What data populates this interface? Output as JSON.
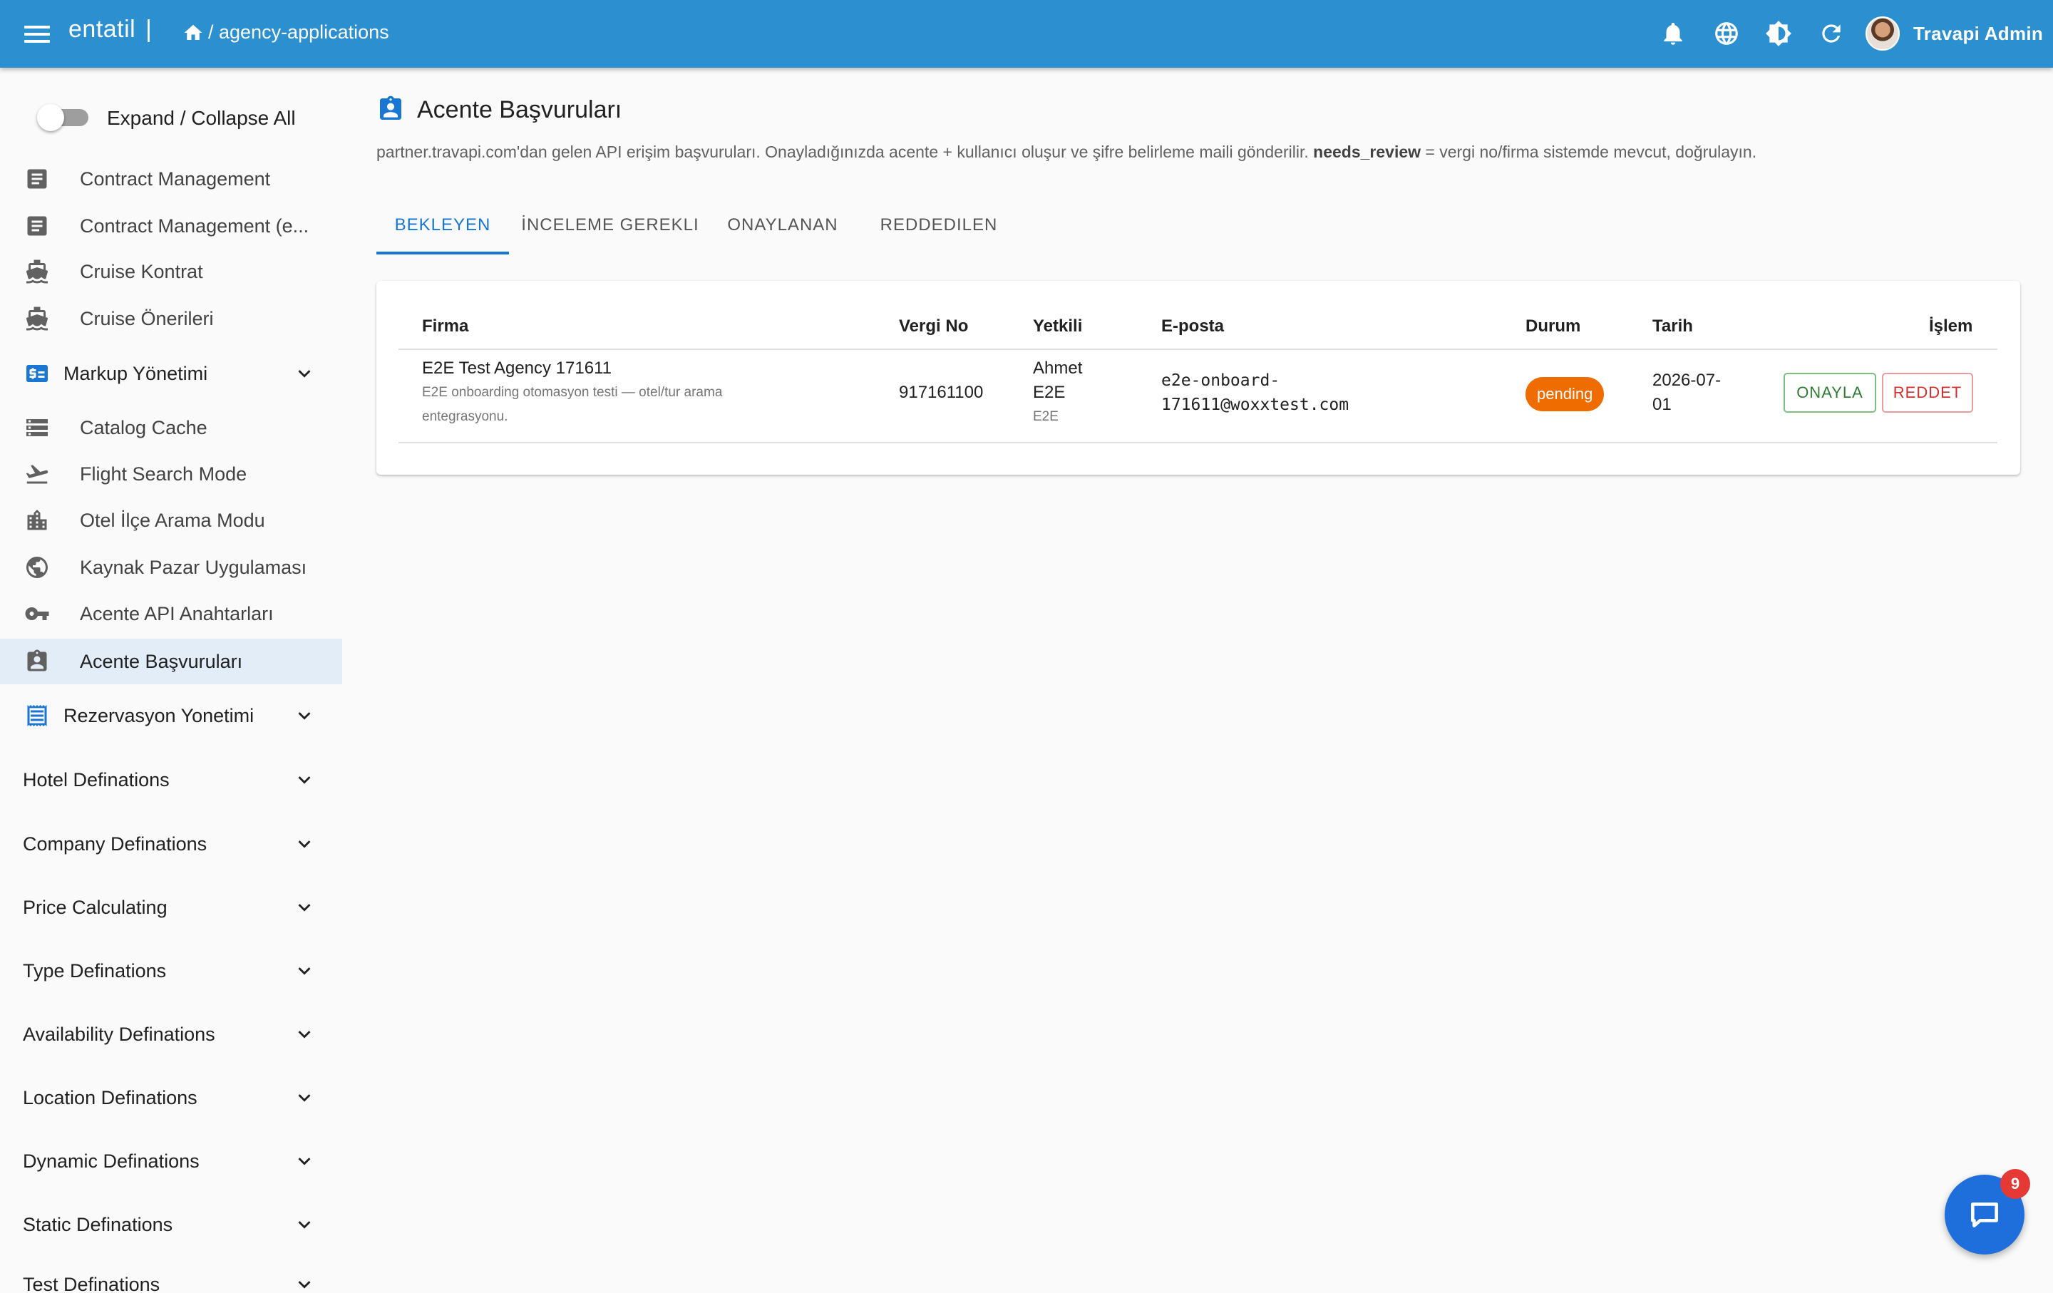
{
  "topbar": {
    "brand": "entatil",
    "brand_sep": "|",
    "breadcrumb": "/ agency-applications",
    "user_name": "Travapi Admin",
    "icons": [
      "menu-icon",
      "home-icon",
      "bell-icon",
      "globe-icon",
      "brightness-icon",
      "refresh-icon",
      "avatar"
    ]
  },
  "sidebar": {
    "toggle_label": "Expand / Collapse All",
    "items": [
      {
        "label": "Contract Management",
        "icon": "contract-icon"
      },
      {
        "label": "Contract Management (e...",
        "icon": "contract-icon"
      },
      {
        "label": "Cruise Kontrat",
        "icon": "ship-icon"
      },
      {
        "label": "Cruise Önerileri",
        "icon": "ship-icon"
      }
    ],
    "markup_group": {
      "label": "Markup Yönetimi",
      "icon": "price-icon"
    },
    "markup_items": [
      {
        "label": "Catalog Cache",
        "icon": "storage-icon"
      },
      {
        "label": "Flight Search Mode",
        "icon": "flight-icon"
      },
      {
        "label": "Otel İlçe Arama Modu",
        "icon": "building-icon"
      },
      {
        "label": "Kaynak Pazar Uygulaması",
        "icon": "public-icon"
      },
      {
        "label": "Acente API Anahtarları",
        "icon": "key-icon"
      },
      {
        "label": "Acente Başvuruları",
        "icon": "assignment-icon",
        "active": true
      }
    ],
    "groups": [
      {
        "label": "Rezervasyon Yonetimi",
        "icon": "receipt-icon"
      },
      {
        "label": "Hotel Definations"
      },
      {
        "label": "Company Definations"
      },
      {
        "label": "Price Calculating"
      },
      {
        "label": "Type Definations"
      },
      {
        "label": "Availability Definations"
      },
      {
        "label": "Location Definations"
      },
      {
        "label": "Dynamic Definations"
      },
      {
        "label": "Static Definations"
      },
      {
        "label": "Test Definations"
      }
    ]
  },
  "page": {
    "title": "Acente Başvuruları",
    "description_pre": "partner.travapi.com'dan gelen API erişim başvuruları. Onayladığınızda acente + kullanıcı oluşur ve şifre belirleme maili gönderilir. ",
    "description_bold": "needs_review",
    "description_post": " = vergi no/firma sistemde mevcut, doğrulayın.",
    "tabs": [
      "BEKLEYEN",
      "İNCELEME GEREKLI",
      "ONAYLANAN",
      "REDDEDILEN"
    ],
    "active_tab": "BEKLEYEN"
  },
  "table": {
    "headers": {
      "firma": "Firma",
      "vergi": "Vergi No",
      "yetkili": "Yetkili",
      "eposta": "E-posta",
      "durum": "Durum",
      "tarih": "Tarih",
      "islem": "İşlem"
    },
    "rows": [
      {
        "firma": "E2E Test Agency 171611",
        "firma_desc_1": "E2E onboarding otomasyon testi — otel/tur arama",
        "firma_desc_2": "entegrasyonu.",
        "vergi": "917161100",
        "yetkili_1": "Ahmet",
        "yetkili_2": "E2E",
        "yetkili_sub": "E2E",
        "eposta_1": "e2e-onboard-",
        "eposta_2": "171611@woxxtest.com",
        "durum": "pending",
        "tarih_1": "2026-07-",
        "tarih_2": "01",
        "approve_label": "ONAYLA",
        "reject_label": "REDDET"
      }
    ]
  },
  "chat": {
    "badge_count": "9"
  },
  "colors": {
    "primary": "#2b8fd0",
    "accent": "#1976d2",
    "pending": "#ef6c00",
    "approve": "#2e7d32",
    "reject": "#d32f2f",
    "fab": "#1e6fdc",
    "badge": "#e53935"
  }
}
